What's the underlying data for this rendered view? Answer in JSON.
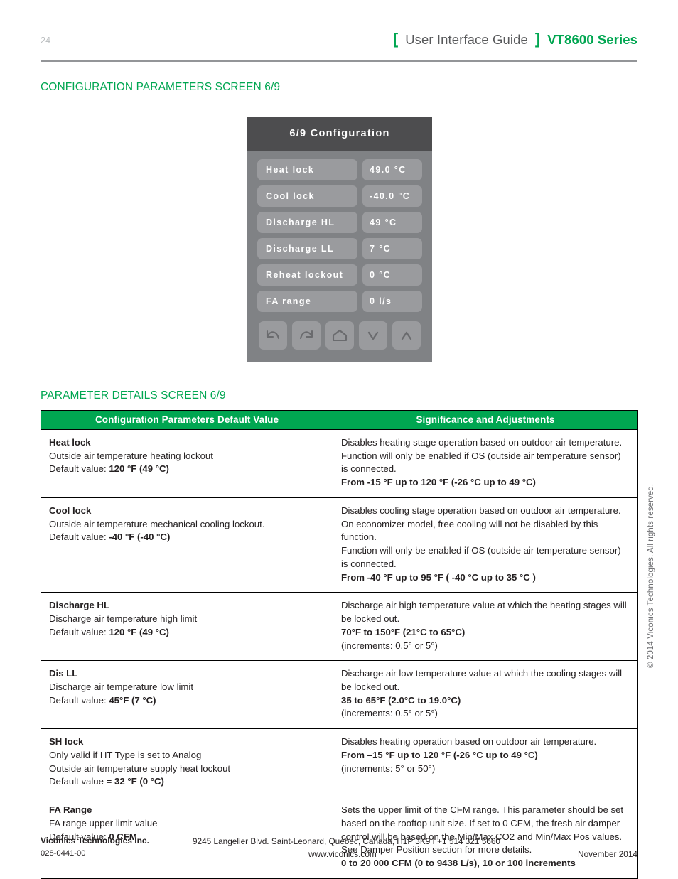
{
  "page": {
    "number": "24",
    "header": {
      "bracket_open": "[",
      "guide_label": "User Interface Guide",
      "bracket_close": "]",
      "series_label": "VT8600 Series"
    },
    "section_title_config": "CONFIGURATION PARAMETERS SCREEN 6/9",
    "section_title_details": "PARAMETER DETAILS SCREEN 6/9",
    "vertical_copyright": "© 2014 Viconics Technologies. All rights reserved."
  },
  "colors": {
    "brand_green": "#00a651",
    "header_gray": "#58595b",
    "rule_gray": "#939598",
    "panel_title_bg": "#4d4d4f",
    "panel_bg": "#808285",
    "panel_button_bg": "#9a9b9e"
  },
  "device_panel": {
    "title": "6/9 Configuration",
    "rows": [
      {
        "key": "Heat lock",
        "value": "49.0 °C"
      },
      {
        "key": "Cool lock",
        "value": "-40.0 °C"
      },
      {
        "key": "Discharge HL",
        "value": "49 °C"
      },
      {
        "key": "Discharge LL",
        "value": "7 °C"
      },
      {
        "key": "Reheat lockout",
        "value": "0 °C"
      },
      {
        "key": "FA range",
        "value": "0 l/s"
      }
    ],
    "nav_buttons": [
      {
        "name": "undo-icon",
        "label": "Back / Undo"
      },
      {
        "name": "redo-icon",
        "label": "Forward / Redo"
      },
      {
        "name": "home-icon",
        "label": "Home"
      },
      {
        "name": "chevron-down-icon",
        "label": "Decrease"
      },
      {
        "name": "chevron-up-icon",
        "label": "Increase"
      }
    ]
  },
  "param_table": {
    "headers": {
      "left": "Configuration Parameters Default Value",
      "right": "Significance and Adjustments"
    },
    "rows": [
      {
        "title": "Heat lock",
        "left_lines": [
          "Outside air temperature heating lockout",
          "Default value: <b>120 °F (49 °C)</b>"
        ],
        "right_lines": [
          "Disables heating stage operation based on outdoor air temperature.",
          "Function will only be enabled if OS (outside air temperature sensor)",
          "is connected.",
          "<b>From -15 °F up to 120 °F (-26 °C up to 49 °C)</b>"
        ]
      },
      {
        "title": "Cool lock",
        "left_lines": [
          "Outside air temperature mechanical cooling lockout.",
          "Default value: <b>-40 °F (-40 °C)</b>"
        ],
        "right_lines": [
          "Disables cooling stage operation based on outdoor air temperature.",
          "On economizer model, free cooling will not be disabled by this",
          "function.",
          "Function will only be enabled if OS (outside air temperature sensor)",
          "is connected.",
          "<b>From -40 °F up to 95 °F ( -40 °C up to 35 °C )</b>"
        ]
      },
      {
        "title": "Discharge HL",
        "left_lines": [
          "Discharge air temperature high limit",
          "Default value: <b>120 °F (49 °C)</b>"
        ],
        "right_lines": [
          "Discharge air high temperature value at which the heating stages will",
          "be locked out.",
          "<b>70°F to 150°F (21°C to 65°C)</b>",
          "(increments: 0.5° or 5°)"
        ]
      },
      {
        "title": "Dis LL",
        "left_lines": [
          "Discharge air temperature low limit",
          "Default value: <b>45°F (7 °C)</b>"
        ],
        "right_lines": [
          "Discharge air low temperature value at which the cooling stages will",
          "be locked out.",
          "<b>35 to 65°F (2.0°C to 19.0°C)</b>",
          "(increments: 0.5° or 5°)"
        ]
      },
      {
        "title": "SH lock",
        "left_lines": [
          "Only valid if HT Type is set to Analog",
          "Outside air temperature supply heat lockout",
          "Default value = <b>32 °F (0 °C)</b>"
        ],
        "right_lines": [
          "Disables heating operation based on outdoor air temperature.",
          "<b>From –15 °F up to 120 °F (-26 °C up to 49 °C)</b>",
          "(increments: 5° or 50°)"
        ]
      },
      {
        "title": "FA Range",
        "left_lines": [
          "FA range upper limit value",
          "Default value: <b>0 CFM</b>"
        ],
        "right_lines": [
          "Sets the upper limit of the CFM range. This parameter should be set",
          "based on the rooftop unit size. If set to 0 CFM, the fresh air damper",
          "control will be based on the Min/Max CO2 and Min/Max Pos values.",
          "See Damper Position section for more details.",
          "<b>0 to 20 000 CFM (0 to 9438 L/s), 10 or 100 increments</b>"
        ]
      }
    ]
  },
  "footer": {
    "company": "Viconics Technologies Inc.",
    "address": "9245 Langelier Blvd. Saint-Leonard, Quebec, Canada, H1P 3K9   I  +1 514 321 5660",
    "doc_number": "028-0441-00",
    "website": "www.viconics.com",
    "date": "November 2014"
  }
}
